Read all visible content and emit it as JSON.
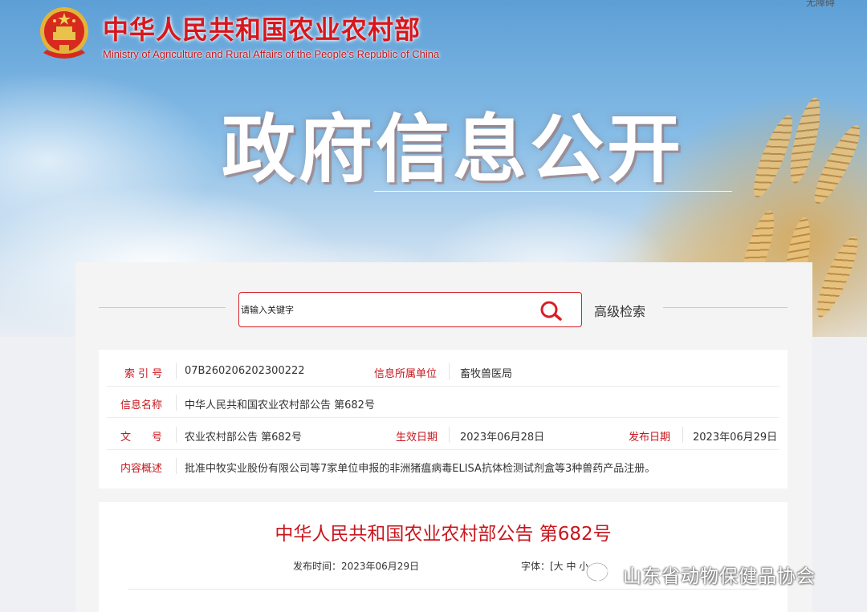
{
  "header": {
    "site_name_cn": "中华人民共和国农业农村部",
    "site_name_en": "Ministry of Agriculture and Rural Affairs of the People's Republic of China",
    "corner_text": "无障碍",
    "banner_title": "政府信息公开",
    "emblem_icon": "national-emblem-icon"
  },
  "search": {
    "placeholder": "请输入关键字",
    "icon": "search-icon",
    "advanced_label": "高级检索"
  },
  "info": {
    "index_label": "索 引 号",
    "index_value": "07B260206202300222",
    "dept_label": "信息所属单位",
    "dept_value": "畜牧兽医局",
    "name_label": "信息名称",
    "name_value": "中华人民共和国农业农村部公告 第682号",
    "doc_label": "文　　号",
    "doc_value": "农业农村部公告 第682号",
    "effective_label": "生效日期",
    "effective_value": "2023年06月28日",
    "publish_label": "发布日期",
    "publish_value": "2023年06月29日",
    "summary_label": "内容概述",
    "summary_value": "批准中牧实业股份有限公司等7家单位申报的非洲猪瘟病毒ELISA抗体检测试剂盒等3种兽药产品注册。"
  },
  "article": {
    "title": "中华人民共和国农业农村部公告 第682号",
    "publish_time": "发布时间：2023年06月29日",
    "font_size": "字体：[大 中 小"
  },
  "watermark": {
    "text": "山东省动物保健品协会",
    "icon": "wechat-icon"
  },
  "colors": {
    "accent_red": "#c8161d",
    "search_border": "#d71f26"
  }
}
